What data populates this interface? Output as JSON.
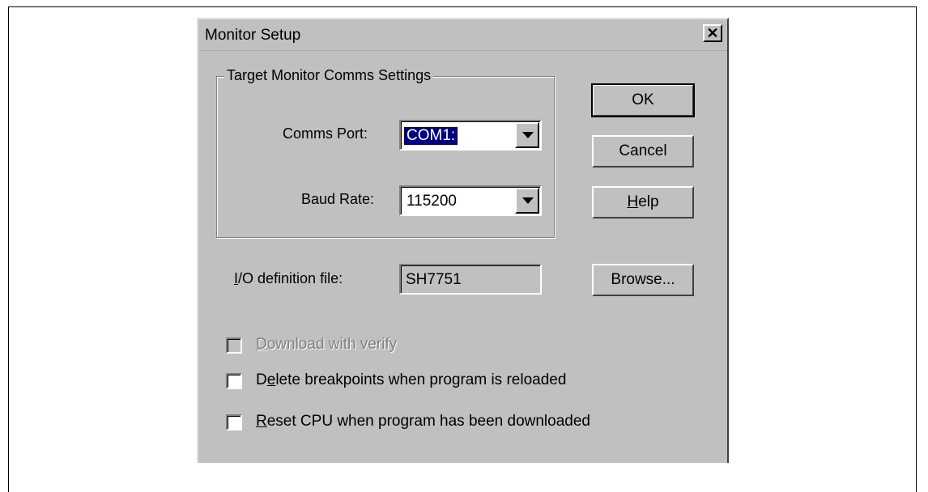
{
  "dialog": {
    "title": "Monitor Setup",
    "close_glyph": "✕"
  },
  "group": {
    "legend": "Target Monitor Comms Settings",
    "comms_port": {
      "label": "Comms Port:",
      "value": "COM1:"
    },
    "baud_rate": {
      "label": "Baud Rate:",
      "value": "115200"
    }
  },
  "io_definition": {
    "label_pre": "",
    "label_mnemonic": "I",
    "label_post": "/O definition file:",
    "value": "SH7751"
  },
  "buttons": {
    "ok": "OK",
    "cancel": "Cancel",
    "help_mnemonic": "H",
    "help_rest": "elp",
    "browse": "Browse..."
  },
  "options": [
    {
      "pre": "",
      "mnemonic": "D",
      "post": "ownload with verify",
      "checked": false,
      "enabled": false
    },
    {
      "pre": "D",
      "mnemonic": "e",
      "post": "lete breakpoints when program is reloaded",
      "checked": false,
      "enabled": true
    },
    {
      "pre": "",
      "mnemonic": "R",
      "post": "eset CPU when program has been downloaded",
      "checked": false,
      "enabled": true
    }
  ],
  "icons": {
    "close": "close-icon",
    "dropdown": "chevron-down-icon"
  }
}
